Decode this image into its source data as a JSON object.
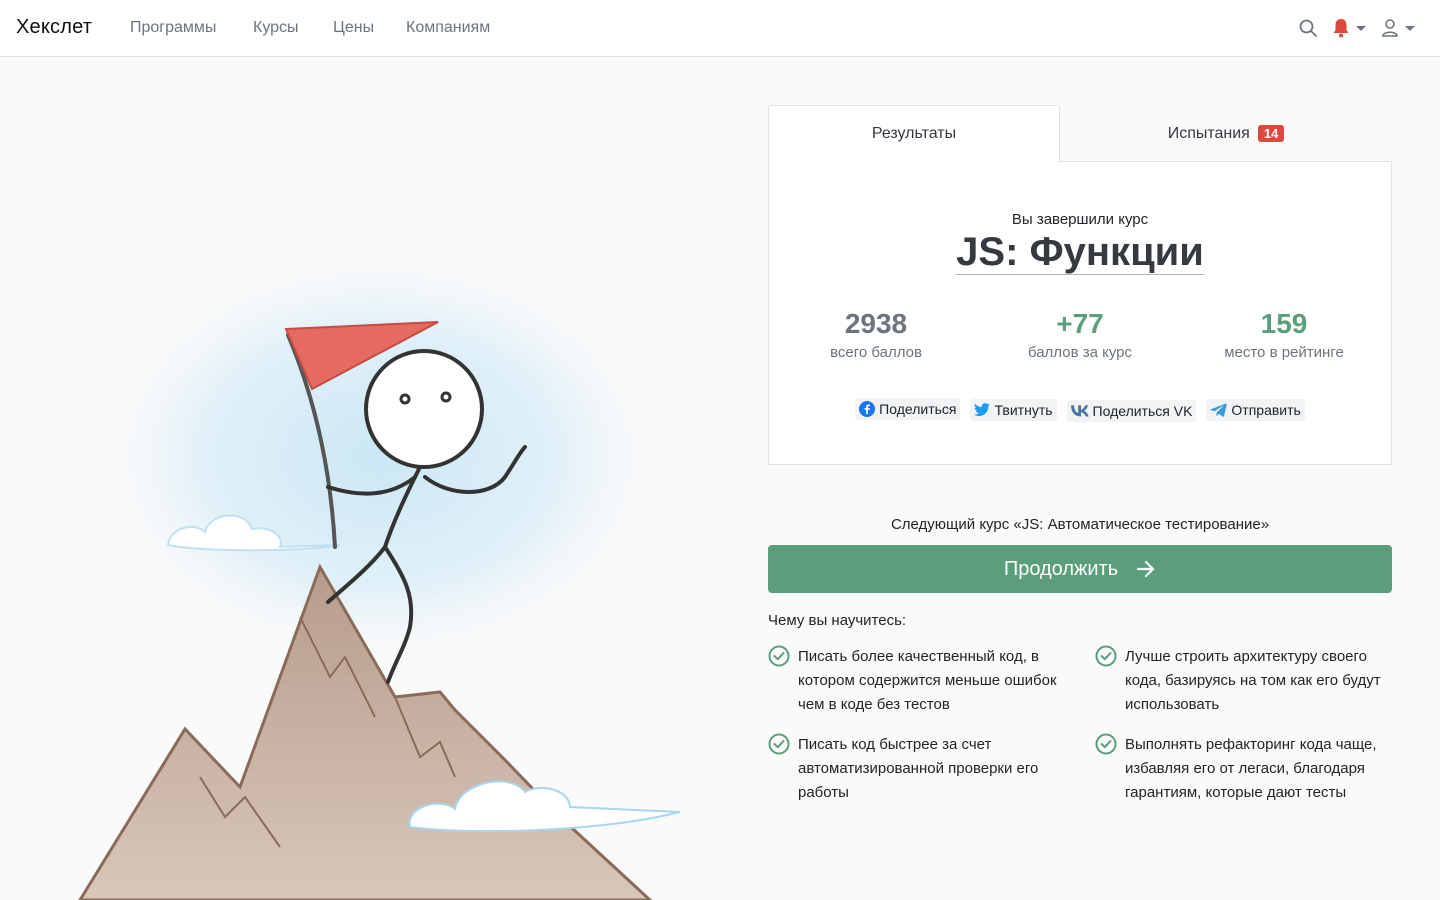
{
  "header": {
    "brand": "Хекслет",
    "nav": [
      {
        "label": "Программы"
      },
      {
        "label": "Курсы"
      },
      {
        "label": "Цены"
      },
      {
        "label": "Компаниям"
      }
    ],
    "icons": [
      "search-icon",
      "bell-icon",
      "user-icon"
    ],
    "bell_color": "#dc4a3d"
  },
  "tabs": {
    "results": "Результаты",
    "challenges": "Испытания",
    "challenges_count": "14"
  },
  "result": {
    "finished_label": "Вы завершили курс",
    "course_title": "JS: Функции",
    "stats": [
      {
        "value": "2938",
        "label": "всего баллов",
        "color": "#6c757d"
      },
      {
        "value": "+77",
        "label": "баллов за курс",
        "color": "#5a9e7c"
      },
      {
        "value": "159",
        "label": "место в рейтинге",
        "color": "#5a9e7c"
      }
    ],
    "share": [
      {
        "label": "Поделиться",
        "icon": "facebook-icon"
      },
      {
        "label": "Твитнуть",
        "icon": "twitter-icon"
      },
      {
        "label": "Поделиться VK",
        "icon": "vk-icon"
      },
      {
        "label": "Отправить",
        "icon": "telegram-icon"
      }
    ]
  },
  "next": {
    "text": "Следующий курс «JS: Автоматическое тестирование»",
    "button": "Продолжить",
    "button_color": "#5a9e7c"
  },
  "learn": {
    "heading": "Чему вы научитесь:",
    "items": [
      {
        "text": "Писать более качественный код, в котором содержится меньше ошибок чем в коде без тестов"
      },
      {
        "text": "Лучше строить архитектуру своего кода, базируясь на том как его будут использовать"
      },
      {
        "text": "Писать код быстрее за счет автоматизированной проверки его работы"
      },
      {
        "text": "Выполнять рефакторинг кода чаще, избавляя его от легаси, благодаря гарантиям, которые дают тесты"
      }
    ]
  }
}
